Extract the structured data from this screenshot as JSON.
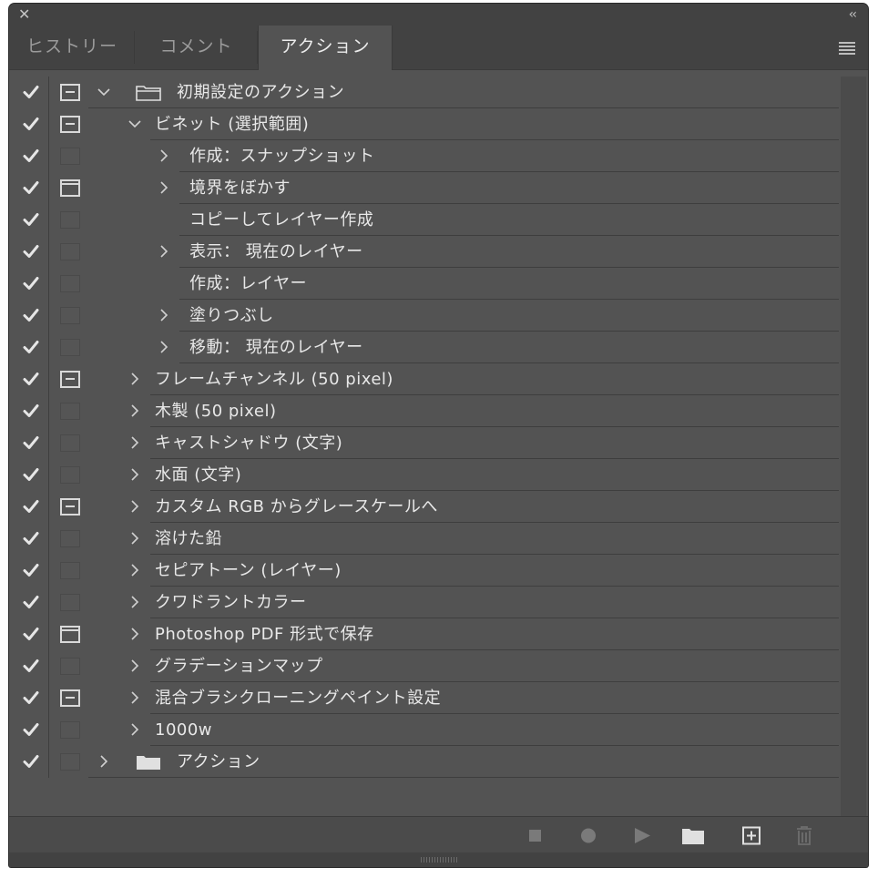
{
  "window": {
    "close_glyph": "✕",
    "collapse_glyph": "‹‹"
  },
  "tabs": [
    {
      "label": "ヒストリー",
      "active": false
    },
    {
      "label": "コメント",
      "active": false
    },
    {
      "label": "アクション",
      "active": true
    }
  ],
  "actions": [
    {
      "label": "初期設定のアクション",
      "level": 0,
      "expanded": true,
      "folder": "open",
      "dialog": "mid",
      "checked": true
    },
    {
      "label": "ビネット (選択範囲)",
      "level": 1,
      "expanded": true,
      "dialog": "mid",
      "checked": true
    },
    {
      "label": "作成：スナップショット",
      "level": 2,
      "expanded": false,
      "dialog": "empty",
      "checked": true
    },
    {
      "label": "境界をぼかす",
      "level": 2,
      "expanded": false,
      "dialog": "top",
      "checked": true
    },
    {
      "label": "コピーしてレイヤー作成",
      "level": 2,
      "expanded": null,
      "dialog": "empty",
      "checked": true
    },
    {
      "label": "表示： 現在のレイヤー",
      "level": 2,
      "expanded": false,
      "dialog": "empty",
      "checked": true
    },
    {
      "label": "作成：レイヤー",
      "level": 2,
      "expanded": null,
      "dialog": "empty",
      "checked": true
    },
    {
      "label": "塗りつぶし",
      "level": 2,
      "expanded": false,
      "dialog": "empty",
      "checked": true
    },
    {
      "label": "移動： 現在のレイヤー",
      "level": 2,
      "expanded": false,
      "dialog": "empty",
      "checked": true
    },
    {
      "label": "フレームチャンネル (50 pixel)",
      "level": 1,
      "expanded": false,
      "dialog": "mid",
      "checked": true
    },
    {
      "label": "木製 (50 pixel)",
      "level": 1,
      "expanded": false,
      "dialog": "empty",
      "checked": true
    },
    {
      "label": "キャストシャドウ (文字)",
      "level": 1,
      "expanded": false,
      "dialog": "empty",
      "checked": true
    },
    {
      "label": "水面 (文字)",
      "level": 1,
      "expanded": false,
      "dialog": "empty",
      "checked": true
    },
    {
      "label": "カスタム RGB からグレースケールへ",
      "level": 1,
      "expanded": false,
      "dialog": "mid",
      "checked": true
    },
    {
      "label": "溶けた鉛",
      "level": 1,
      "expanded": false,
      "dialog": "empty",
      "checked": true
    },
    {
      "label": "セピアトーン (レイヤー)",
      "level": 1,
      "expanded": false,
      "dialog": "empty",
      "checked": true
    },
    {
      "label": "クワドラントカラー",
      "level": 1,
      "expanded": false,
      "dialog": "empty",
      "checked": true
    },
    {
      "label": "Photoshop PDF 形式で保存",
      "level": 1,
      "expanded": false,
      "dialog": "top",
      "checked": true
    },
    {
      "label": "グラデーションマップ",
      "level": 1,
      "expanded": false,
      "dialog": "empty",
      "checked": true
    },
    {
      "label": "混合ブラシクローニングペイント設定",
      "level": 1,
      "expanded": false,
      "dialog": "mid",
      "checked": true
    },
    {
      "label": "1000w",
      "level": 1,
      "expanded": false,
      "dialog": "empty",
      "checked": true
    },
    {
      "label": "アクション",
      "level": 0,
      "expanded": false,
      "folder": "closed",
      "dialog": "empty",
      "checked": true
    }
  ],
  "footer_buttons": [
    {
      "name": "stop-icon"
    },
    {
      "name": "record-icon"
    },
    {
      "name": "play-icon"
    },
    {
      "name": "new-set-folder-icon"
    },
    {
      "name": "new-action-icon"
    },
    {
      "name": "trash-icon"
    }
  ],
  "colors": {
    "panel": "#535353",
    "tabbar": "#424242",
    "text": "#e8e8e8",
    "icon": "#d9d9d9"
  }
}
